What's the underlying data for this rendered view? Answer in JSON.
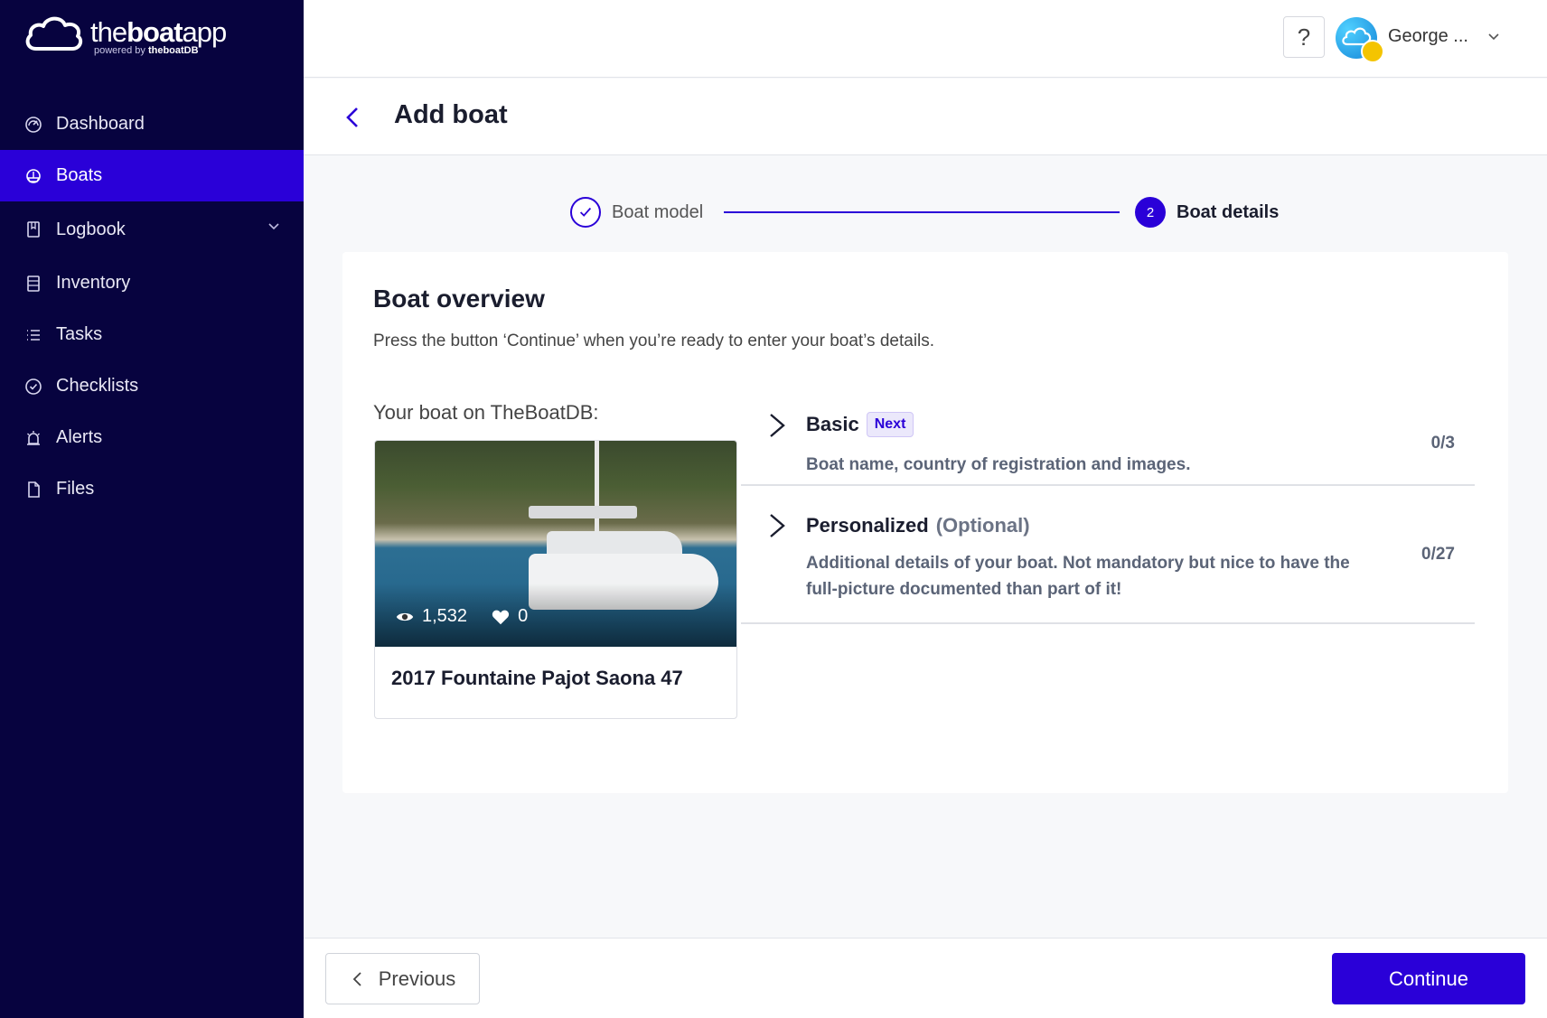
{
  "brand": {
    "name_light": "the",
    "name_bold": "boat",
    "name_tail": "app",
    "powered_by": "powered by",
    "powered_brand": "theboatDB"
  },
  "sidebar": {
    "items": [
      {
        "label": "Dashboard",
        "icon": "gauge-icon"
      },
      {
        "label": "Boats",
        "icon": "boat-icon",
        "active": true
      },
      {
        "label": "Logbook",
        "icon": "book-icon",
        "expandable": true
      },
      {
        "label": "Inventory",
        "icon": "inventory-icon"
      },
      {
        "label": "Tasks",
        "icon": "list-icon"
      },
      {
        "label": "Checklists",
        "icon": "check-circle-icon"
      },
      {
        "label": "Alerts",
        "icon": "alarm-icon"
      },
      {
        "label": "Files",
        "icon": "file-icon"
      }
    ]
  },
  "topbar": {
    "help_label": "?",
    "user_name": "George ..."
  },
  "header": {
    "title": "Add boat"
  },
  "stepper": {
    "steps": [
      {
        "label": "Boat model",
        "state": "done"
      },
      {
        "number": "2",
        "label": "Boat details",
        "state": "current"
      }
    ]
  },
  "overview": {
    "title": "Boat overview",
    "description": "Press the button ‘Continue’ when you’re ready to enter your boat’s details.",
    "boat_label": "Your boat on TheBoatDB:",
    "boat": {
      "views": "1,532",
      "likes": "0",
      "name": "2017 Fountaine Pajot Saona 47"
    },
    "sections": [
      {
        "title": "Basic",
        "badge": "Next",
        "description": "Boat name, country of registration and images.",
        "count": "0/3"
      },
      {
        "title": "Personalized",
        "optional": "(Optional)",
        "description_line1": "Additional details of your boat. Not mandatory but nice to have the",
        "description_line2": "full-picture documented than part of it!",
        "count": "0/27"
      }
    ]
  },
  "footer": {
    "previous_label": "Previous",
    "continue_label": "Continue"
  },
  "colors": {
    "sidebar_bg": "#07033f",
    "accent": "#2a00d8",
    "badge_bg": "#ebe8fb"
  }
}
